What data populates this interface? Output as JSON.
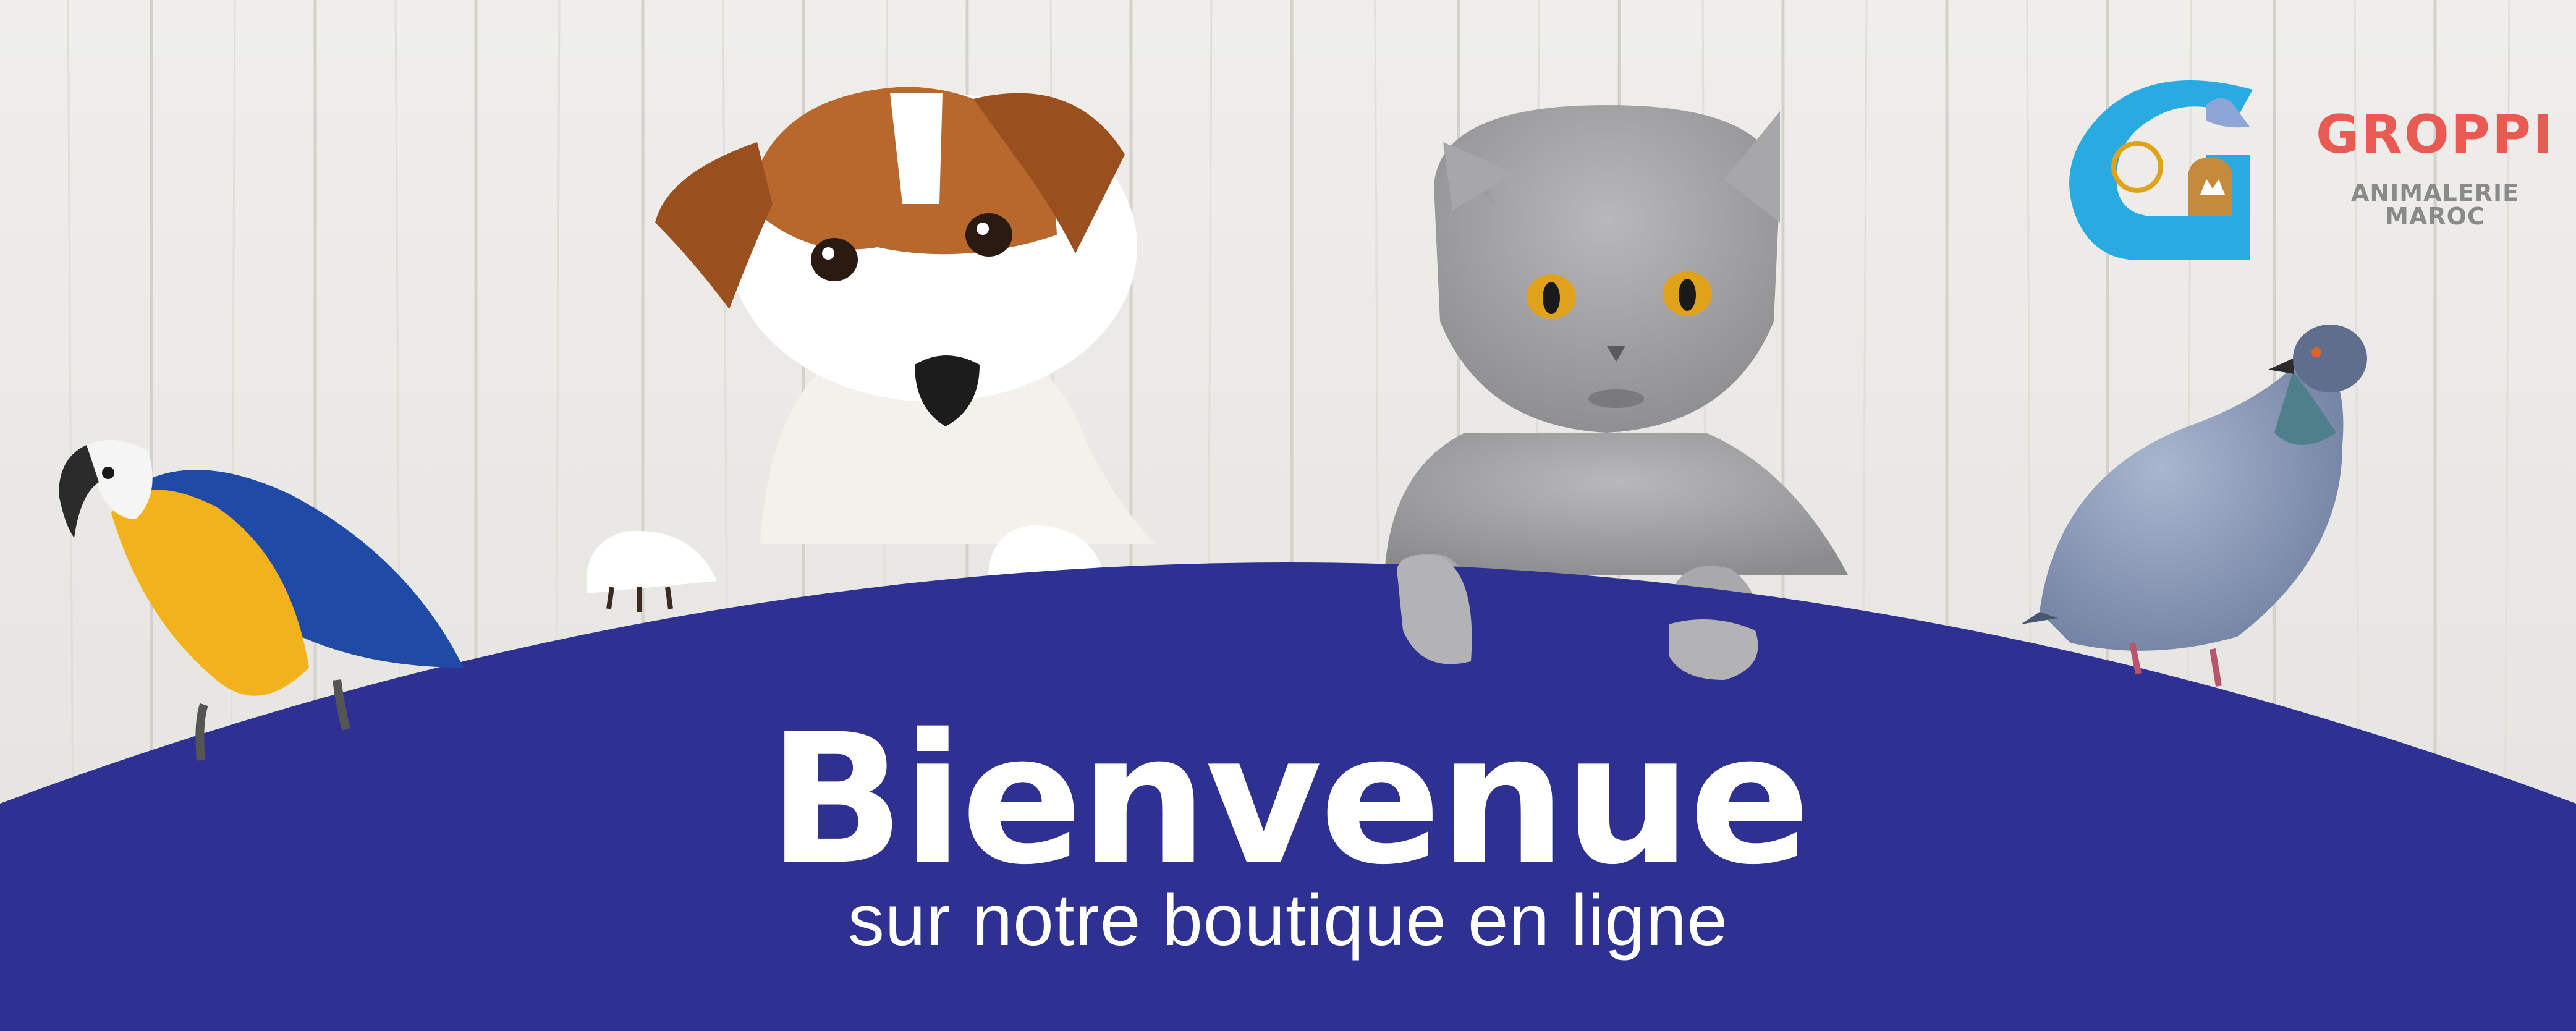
{
  "hero": {
    "title": "Bienvenue",
    "subtitle": "sur notre boutique en ligne"
  },
  "brand": {
    "name": "GROPPI",
    "tagline": "ANIMALERIE MAROC",
    "logo_letter": "G"
  },
  "colors": {
    "banner_blue": "#2e3192",
    "logo_blue": "#29abe2",
    "brand_red": "#e85a52",
    "tagline_gray": "#8a8a8a",
    "wood_background": "#eceae6"
  },
  "images": [
    "macaw-parrot",
    "jack-russell-dog",
    "british-shorthair-cat",
    "pigeon"
  ]
}
